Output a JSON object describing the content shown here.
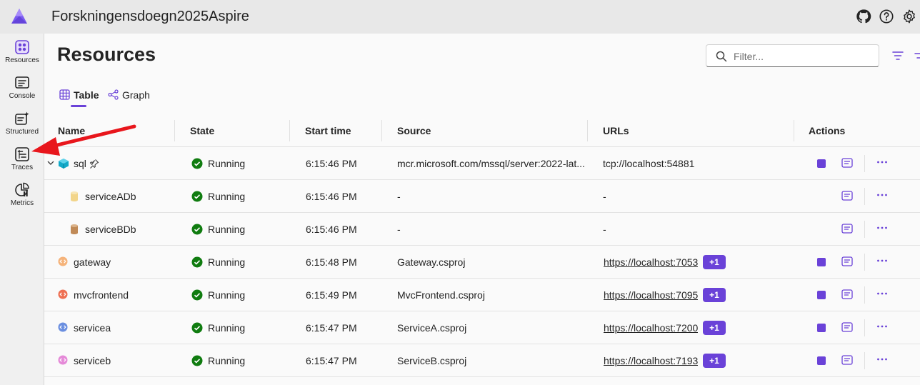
{
  "app": {
    "title": "Forskningensdoegn2025Aspire"
  },
  "sidebar": {
    "items": [
      {
        "label": "Resources",
        "icon": "resources-icon",
        "active": true
      },
      {
        "label": "Console",
        "icon": "console-icon"
      },
      {
        "label": "Structured",
        "icon": "structured-logs-icon"
      },
      {
        "label": "Traces",
        "icon": "traces-icon"
      },
      {
        "label": "Metrics",
        "icon": "metrics-icon"
      }
    ]
  },
  "page": {
    "title": "Resources",
    "search_placeholder": "Filter...",
    "tabs": [
      {
        "label": "Table",
        "active": true
      },
      {
        "label": "Graph"
      }
    ]
  },
  "table": {
    "columns": [
      "Name",
      "State",
      "Start time",
      "Source",
      "URLs",
      "Actions"
    ],
    "rows": [
      {
        "name": "sql",
        "state": "Running",
        "start": "6:15:46 PM",
        "source": "mcr.microsoft.com/mssql/server:2022-lat...",
        "url": "tcp://localhost:54881",
        "url_is_link": false,
        "extra": "",
        "icon": "container-icon",
        "expandable": true,
        "pinned": true,
        "has_stop": true
      },
      {
        "name": "serviceADb",
        "state": "Running",
        "start": "6:15:46 PM",
        "source": "-",
        "url": "-",
        "url_is_link": false,
        "extra": "",
        "icon": "database-icon",
        "child": true,
        "has_stop": false
      },
      {
        "name": "serviceBDb",
        "state": "Running",
        "start": "6:15:46 PM",
        "source": "-",
        "url": "-",
        "url_is_link": false,
        "extra": "",
        "icon": "database-icon",
        "child": true,
        "has_stop": false
      },
      {
        "name": "gateway",
        "state": "Running",
        "start": "6:15:48 PM",
        "source": "Gateway.csproj",
        "url": "https://localhost:7053",
        "url_is_link": true,
        "extra": "+1",
        "icon": "project-icon",
        "has_stop": true
      },
      {
        "name": "mvcfrontend",
        "state": "Running",
        "start": "6:15:49 PM",
        "source": "MvcFrontend.csproj",
        "url": "https://localhost:7095",
        "url_is_link": true,
        "extra": "+1",
        "icon": "project-icon",
        "has_stop": true
      },
      {
        "name": "servicea",
        "state": "Running",
        "start": "6:15:47 PM",
        "source": "ServiceA.csproj",
        "url": "https://localhost:7200",
        "url_is_link": true,
        "extra": "+1",
        "icon": "project-icon",
        "has_stop": true
      },
      {
        "name": "serviceb",
        "state": "Running",
        "start": "6:15:47 PM",
        "source": "ServiceB.csproj",
        "url": "https://localhost:7193",
        "url_is_link": true,
        "extra": "+1",
        "icon": "project-icon",
        "has_stop": true
      }
    ]
  },
  "colors": {
    "accent": "#6a42d8",
    "running": "#107c10",
    "annotation_arrow": "#e8161c",
    "icons": [
      "#12a9c8",
      "#f2d58a",
      "#c08a57",
      "#f5b37a",
      "#ee6f52",
      "#6b8fe0",
      "#e58ad8"
    ]
  }
}
